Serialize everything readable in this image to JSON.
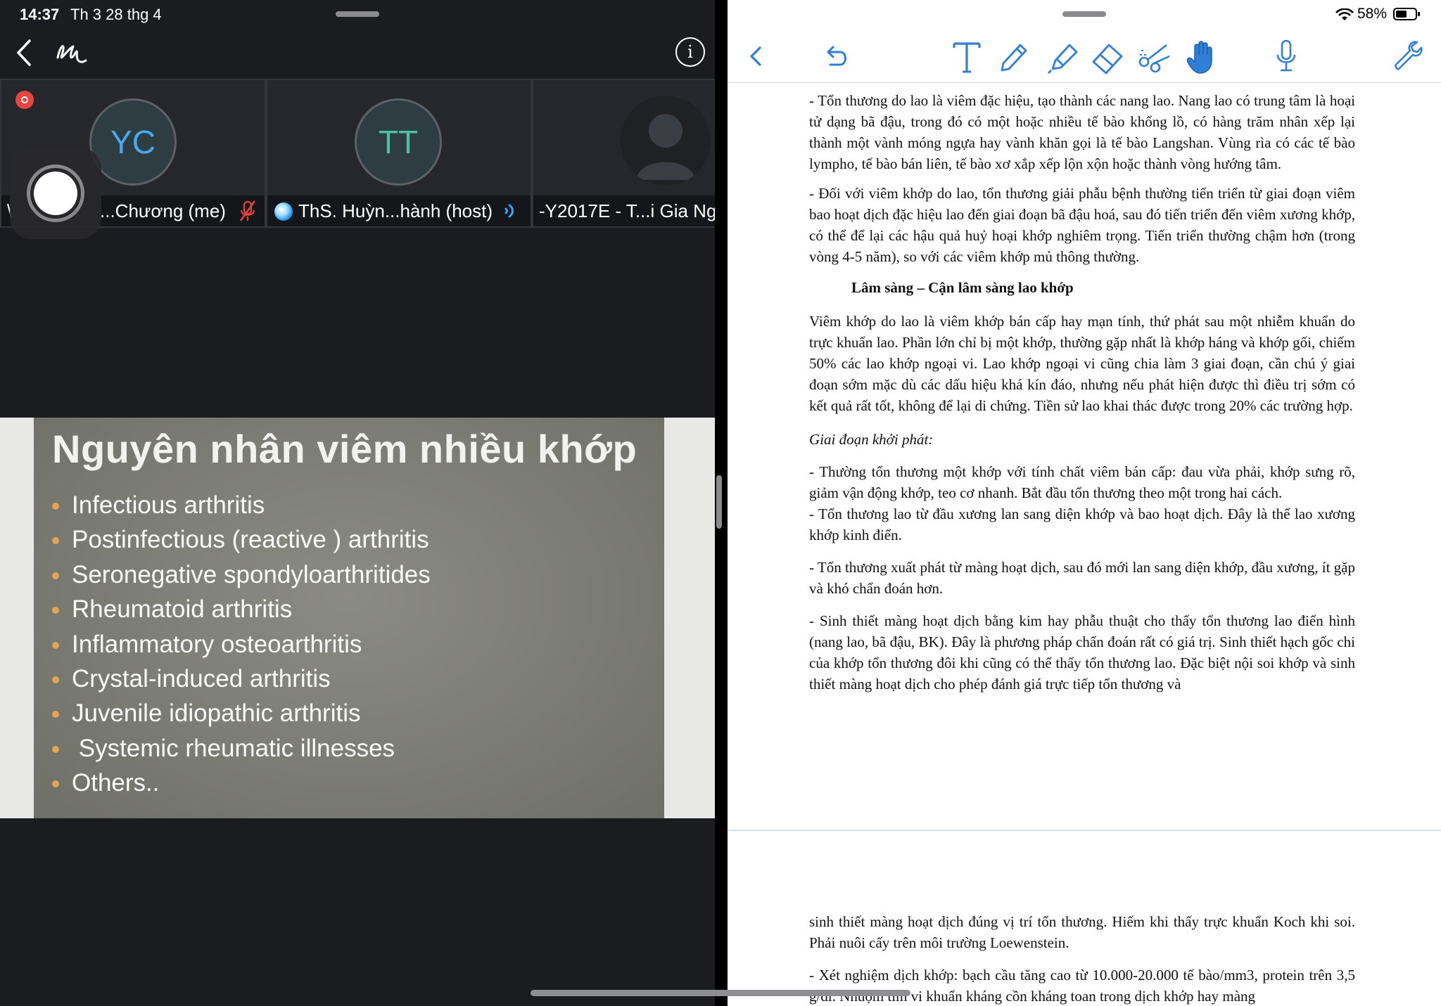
{
  "left_status": {
    "time": "14:37",
    "date": "Th 3 28 thg 4"
  },
  "participants": [
    {
      "initials": "YC",
      "name": "...Chương (me)"
    },
    {
      "initials": "TT",
      "name": "ThS. Huỳn...hành (host)"
    },
    {
      "initials": "",
      "name": "-Y2017E - T...i Gia Ng"
    }
  ],
  "slide": {
    "title": "Nguyên nhân viêm nhiều khớp",
    "bullets": [
      "Infectious arthritis",
      "Postinfectious (reactive ) arthritis",
      "Seronegative spondyloarthritides",
      "Rheumatoid arthritis",
      "Inflammatory osteoarthritis",
      "Crystal-induced arthritis",
      "Juvenile idiopathic arthritis",
      " Systemic rheumatic illnesses",
      "Others.."
    ]
  },
  "right_status": {
    "battery": "58%",
    "battery_level": 0.58
  },
  "colors": {
    "zoom_bg": "#1a1c20",
    "tool_blue": "#2f7fd6",
    "slide_bullet": "#e2a556",
    "rec_red": "#e8453f"
  },
  "toolbar_icons": [
    "back-icon",
    "undo-icon",
    "text-tool-icon",
    "pen-icon",
    "highlighter-icon",
    "eraser-icon",
    "scissors-icon",
    "hand-icon",
    "microphone-icon",
    "wrench-icon"
  ],
  "document": {
    "p1": "- Tổn thương do lao là viêm đặc hiệu, tạo thành các nang lao. Nang lao có trung tâm là hoại tử dạng bã đậu, trong đó có một hoặc nhiều tế bào khổng lồ, có hàng trăm nhân xếp lại thành một vành móng ngựa hay vành khăn gọi là tế bào Langshan. Vùng rìa có các tế bào lympho, tế bào bán liên, tế bào xơ xắp xếp lộn xộn hoặc thành vòng hướng tâm.",
    "p2": "- Đối với viêm khớp do lao, tổn thương giải phẫu bệnh thường tiến triển từ giai đoạn viêm bao hoạt dịch đặc hiệu lao đến giai đoạn bã đậu hoá, sau đó tiến triển đến viêm xương khớp, có thể để lại các hậu quả huỷ hoại khớp nghiêm trọng. Tiến triển thường chậm hơn (trong vòng 4-5 năm), so với các viêm khớp mủ thông thường.",
    "heading": "Lâm sàng – Cận lâm sàng lao khớp",
    "p3": "Viêm khớp do lao là viêm khớp bán cấp hay mạn tính, thứ phát sau một nhiễm khuẩn do trực khuẩn lao. Phần lớn chỉ bị một khớp, thường gặp nhất là khớp háng và khớp gối, chiếm 50% các lao khớp ngoại vi. Lao khớp ngoại vi cũng chia làm 3 giai đoạn, cần chú ý giai đoạn sớm mặc dù các dấu hiệu khá kín đáo, nhưng nếu phát hiện được thì điều trị sớm có kết quả rất tốt, không để lại di chứng. Tiền sử lao khai thác được trong 20% các trường hợp.",
    "subheading": "Giai đoạn khởi phát:",
    "p4": "- Thường tổn thương một khớp với tính chất viêm bán cấp: đau vừa phải, khớp sưng rõ, giảm vận động khớp, teo cơ nhanh. Bắt đầu tổn thương theo một trong hai cách.",
    "p5": "- Tổn thương lao từ đầu xương lan sang diện khớp và bao hoạt dịch. Đây là thể lao xương khớp kinh điển.",
    "p6": "- Tổn thương xuất phát từ màng hoạt dịch, sau đó mới lan sang diện khớp, đầu xương, ít gặp và khó chẩn đoán hơn.",
    "p7": "- Sinh thiết màng hoạt dịch bằng kim hay phẫu thuật cho thấy tổn thương lao điển hình (nang lao, bã đậu, BK). Đây là phương pháp chẩn đoán rất có giá trị. Sinh thiết hạch gốc chi của khớp tổn thương đôi khi cũng có thể thấy tổn thương lao. Đặc biệt nội soi khớp và sinh thiết màng hoạt dịch cho phép đánh giá trực tiếp tổn thương và",
    "p8": "sinh thiết màng hoạt dịch đúng vị trí tổn thương. Hiếm khi thấy trực khuẩn Koch khi soi. Phải nuôi cấy trên môi trường Loewenstein.",
    "p9": "- Xét nghiệm dịch khớp: bạch cầu tăng cao từ 10.000-20.000 tế bào/mm3, protein trên 3,5 g/dl. Nhuộm tìm vi khuẩn kháng cồn kháng toan trong dịch khớp hay màng"
  }
}
